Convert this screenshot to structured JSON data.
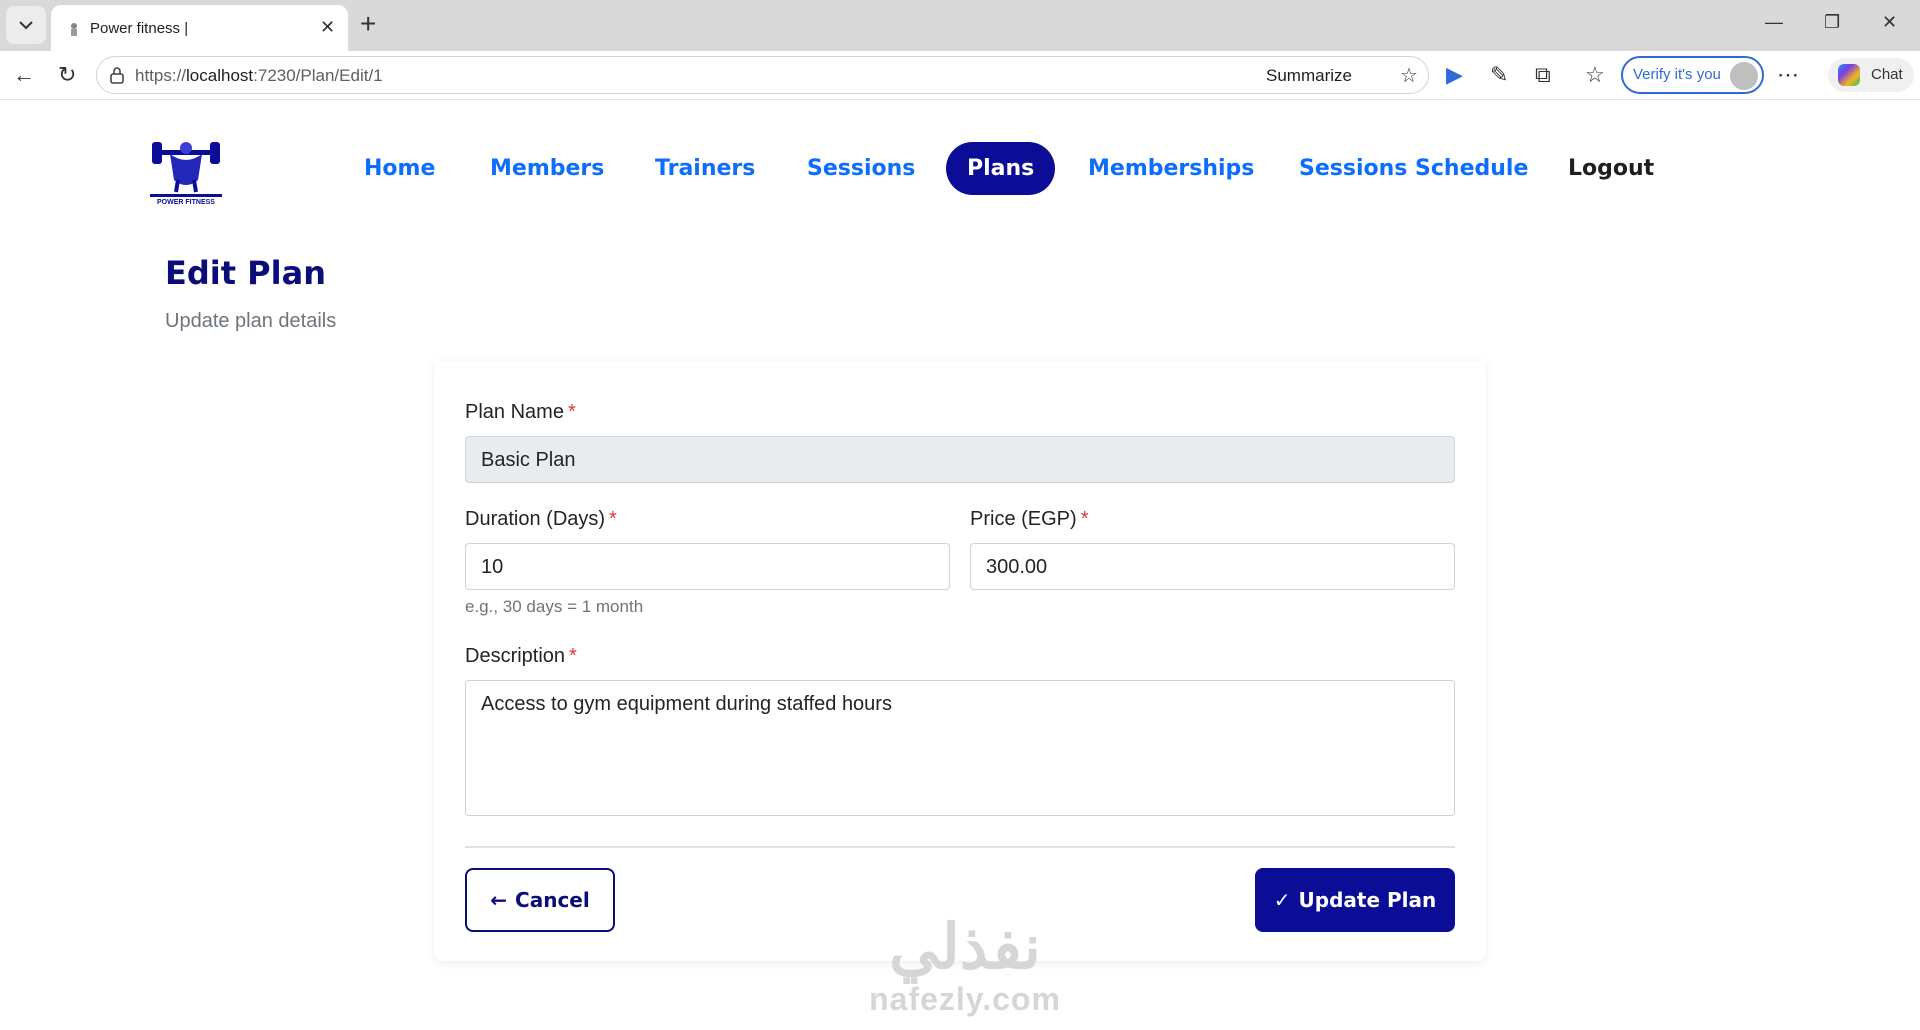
{
  "browser": {
    "tab_title": "Power fitness |",
    "url_prefix": "https://",
    "url_host": "localhost",
    "url_rest": ":7230/Plan/Edit/1",
    "summarize_label": "Summarize",
    "verify_label": "Verify it's you",
    "chat_label": "Chat"
  },
  "site": {
    "logo_text": "POWER FITNESS",
    "nav": {
      "home": "Home",
      "members": "Members",
      "trainers": "Trainers",
      "sessions": "Sessions",
      "plans": "Plans",
      "memberships": "Memberships",
      "sessions_schedule": "Sessions Schedule",
      "logout": "Logout"
    }
  },
  "page": {
    "title": "Edit Plan",
    "subtitle": "Update plan details"
  },
  "form": {
    "plan_name_label": "Plan Name",
    "plan_name_value": "Basic Plan",
    "duration_label": "Duration (Days)",
    "duration_value": "10",
    "duration_hint": "e.g., 30 days = 1 month",
    "price_label": "Price (EGP)",
    "price_value": "300.00",
    "description_label": "Description",
    "description_value": "Access to gym equipment during staffed hours",
    "required_mark": "*",
    "cancel_label": "Cancel",
    "update_label": "Update Plan"
  },
  "watermark": {
    "arabic": "نفذلي",
    "latin": "nafezly.com"
  },
  "colors": {
    "brand": "#0b0d96",
    "link": "#0d6efd",
    "required": "#dc3545"
  }
}
